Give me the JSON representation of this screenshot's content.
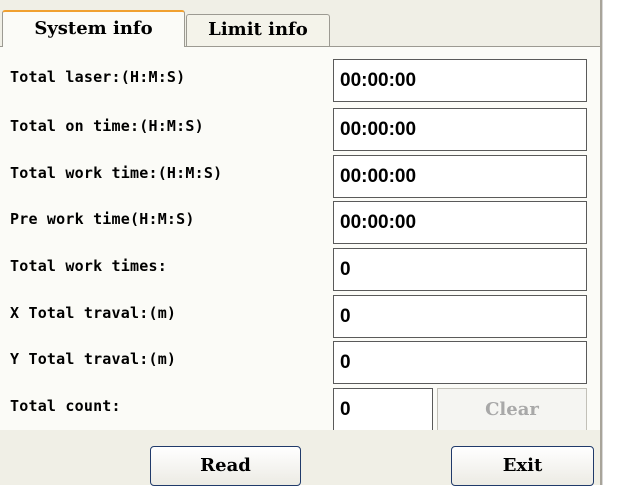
{
  "tabs": [
    {
      "label": "System info",
      "active": true
    },
    {
      "label": "Limit info",
      "active": false
    }
  ],
  "rows": [
    {
      "label": "Total laser:(H:M:S)",
      "value": "00:00:00"
    },
    {
      "label": "Total on time:(H:M:S)",
      "value": "00:00:00"
    },
    {
      "label": "Total work time:(H:M:S)",
      "value": "00:00:00"
    },
    {
      "label": "Pre work time(H:M:S)",
      "value": "00:00:00"
    },
    {
      "label": "Total work times:",
      "value": "0"
    },
    {
      "label": "X Total traval:(m)",
      "value": "0"
    },
    {
      "label": "Y Total traval:(m)",
      "value": "0"
    },
    {
      "label": "Total count:",
      "value": "0"
    }
  ],
  "buttons": {
    "clear_label": "Clear",
    "read_label": "Read",
    "exit_label": "Exit"
  },
  "colors": {
    "active_tab_accent": "#f0a030",
    "disabled_text": "#a8a8a8",
    "window_bg": "#f0efe6"
  }
}
